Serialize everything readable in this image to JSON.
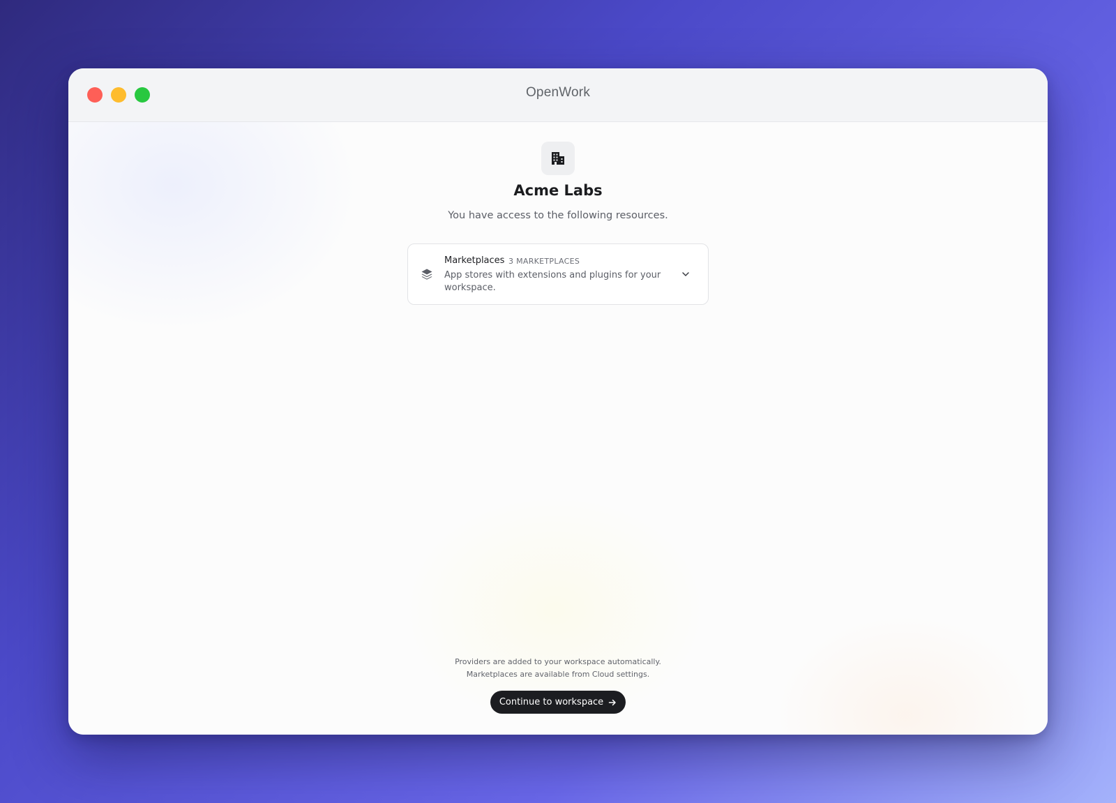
{
  "window": {
    "title": "OpenWork"
  },
  "org": {
    "name": "Acme Labs",
    "subtitle": "You have access to the following resources.",
    "icon": "building-icon"
  },
  "resources": [
    {
      "title": "Marketplaces",
      "count_label": "3 MARKETPLACES",
      "description": "App stores with extensions and plugins for your workspace.",
      "icon": "layers-icon",
      "expanded": false
    }
  ],
  "footer": {
    "line1": "Providers are added to your workspace automatically.",
    "line2": "Marketplaces are available from Cloud settings."
  },
  "actions": {
    "continue_label": "Continue to workspace",
    "continue_icon": "arrow-right-icon"
  },
  "colors": {
    "traffic_red": "#fe5f57",
    "traffic_yellow": "#febc2e",
    "traffic_green": "#28c840",
    "button_bg": "#1c1d21"
  }
}
